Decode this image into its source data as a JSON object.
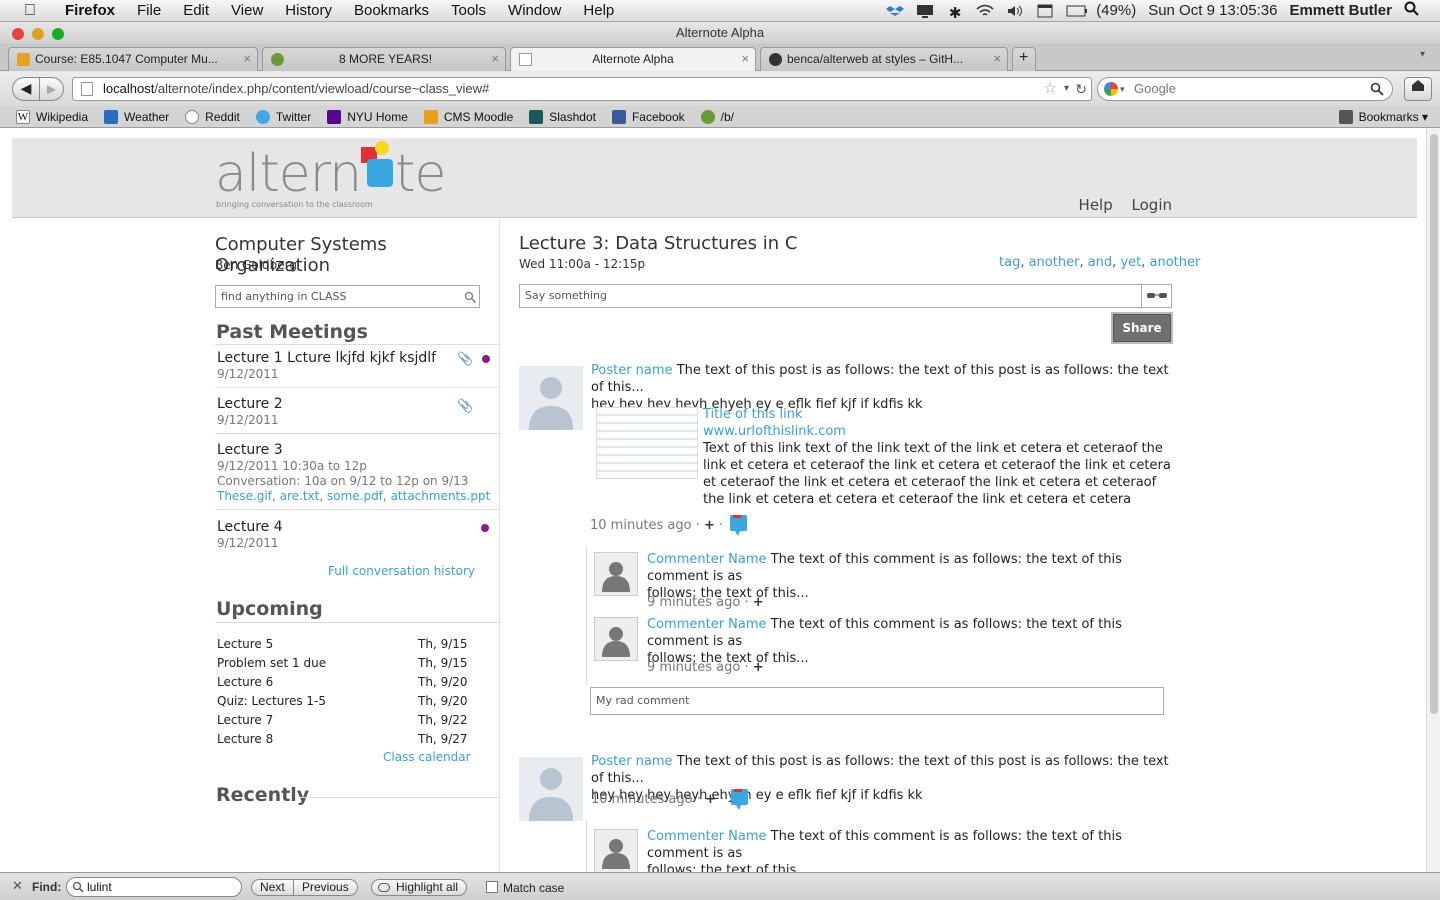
{
  "menubar": {
    "app": "Firefox",
    "items": [
      "File",
      "Edit",
      "View",
      "History",
      "Bookmarks",
      "Tools",
      "Window",
      "Help"
    ],
    "battery": "(49%)",
    "clock": "Sun Oct 9  13:05:36",
    "user": "Emmett Butler"
  },
  "window": {
    "title": "Alternote Alpha"
  },
  "tabs": [
    {
      "label": "Course: E85.1047 Computer Mu..."
    },
    {
      "label": "8 MORE YEARS!"
    },
    {
      "label": "Alternote Alpha"
    },
    {
      "label": "benca/alterweb at styles – GitH..."
    }
  ],
  "nav": {
    "url_host": "localhost",
    "url_path": "/alternote/index.php/content/viewload/course~class_view#",
    "search_placeholder": "Google"
  },
  "bookmarks": [
    {
      "label": "Wikipedia",
      "color": "#ffffff"
    },
    {
      "label": "Weather",
      "color": "#2a6cc4"
    },
    {
      "label": "Reddit",
      "color": "#ffffff"
    },
    {
      "label": "Twitter",
      "color": "#3fa9e8"
    },
    {
      "label": "NYU Home",
      "color": "#57068c"
    },
    {
      "label": "CMS Moodle",
      "color": "#e8a020"
    },
    {
      "label": "Slashdot",
      "color": "#1a5a5a"
    },
    {
      "label": "Facebook",
      "color": "#3b5998"
    },
    {
      "label": "/b/",
      "color": "#6a9a3a"
    }
  ],
  "bookmarks_menu": "Bookmarks",
  "site": {
    "logo": "altern",
    "logo_tail": "te",
    "tagline": "bringing conversation to the classroom",
    "help": "Help",
    "login": "Login"
  },
  "course": {
    "title": "Computer Systems Organization",
    "instructor": "Ben Goldberg",
    "search_placeholder": "find anything in CLASS"
  },
  "past": {
    "heading": "Past Meetings",
    "meetings": [
      {
        "title": "Lecture 1 Lcture lkjfd kjkf ksjdlf",
        "date": "9/12/2011"
      },
      {
        "title": "Lecture 2",
        "date": "9/12/2011"
      },
      {
        "title": "Lecture 3",
        "date": "9/12/2011 10:30a to 12p",
        "conversation": "Conversation: 10a on 9/12 to 12p on 9/13",
        "attachments": [
          "These.gif",
          "are.txt",
          "some.pdf",
          "attachments.ppt"
        ]
      },
      {
        "title": "Lecture 4",
        "date": "9/12/2011"
      }
    ],
    "history_link": "Full conversation history"
  },
  "upcoming": {
    "heading": "Upcoming",
    "items": [
      {
        "name": "Lecture 5",
        "date": "Th, 9/15"
      },
      {
        "name": "Problem set 1 due",
        "date": "Th, 9/15"
      },
      {
        "name": "Lecture 6",
        "date": "Th, 9/20"
      },
      {
        "name": "Quiz: Lectures 1-5",
        "date": "Th, 9/20"
      },
      {
        "name": "Lecture 7",
        "date": "Th, 9/22"
      },
      {
        "name": "Lecture 8",
        "date": "Th, 9/27"
      }
    ],
    "calendar_link": "Class calendar"
  },
  "recently": {
    "heading": "Recently"
  },
  "lecture": {
    "title": "Lecture 3: Data Structures in C",
    "time": "Wed 11:00a - 12:15p",
    "tags": [
      "tag",
      "another",
      "and",
      "yet",
      "another"
    ],
    "say_placeholder": "Say something",
    "share": "Share"
  },
  "posts": [
    {
      "poster": "Poster name",
      "text": "The text of this post is as follows: the text of this post is as follows: the text of this...",
      "text2": "hey hey hey heyh ehyeh ey e eflk fief kjf if kdfis kk",
      "link_title": "Title of this link",
      "link_url": "www.urlofthislink.com",
      "link_desc": "Text of this link text of the link text of the link et cetera et ceteraof the link et cetera et ceteraof the link et cetera et ceteraof the link et cetera et ceteraof the link et cetera et ceteraof the link et cetera et ceteraof the link et cetera et cetera et ceteraof the link et cetera et cetera",
      "time": "10 minutes ago",
      "comments": [
        {
          "name": "Commenter Name",
          "text": "The text of this comment is as follows: the text of this comment is as",
          "text2": "follows: the text of this...",
          "time": "9 minutes ago"
        },
        {
          "name": "Commenter Name",
          "text": "The text of this comment is as follows: the text of this comment is as",
          "text2": "follows: the text of this...",
          "time": "9 minutes ago"
        }
      ],
      "comment_value": "My rad comment"
    },
    {
      "poster": "Poster name",
      "text": "The text of this post is as follows: the text of this post is as follows: the text of this...",
      "text2": "hey hey hey heyh ehyeh ey e eflk fief kjf if kdfis kk",
      "time": "10 minutes ago",
      "comments": [
        {
          "name": "Commenter Name",
          "text": "The text of this comment is as follows: the text of this comment is as",
          "text2": "follows: the text of this..."
        }
      ]
    }
  ],
  "findbar": {
    "label": "Find:",
    "value": "lulint",
    "next": "Next",
    "previous": "Previous",
    "highlight": "Highlight all",
    "match_case": "Match case"
  },
  "colors": {
    "link": "#3a9fd8",
    "dot": "#8b1a8b",
    "share_bg": "#707070"
  }
}
